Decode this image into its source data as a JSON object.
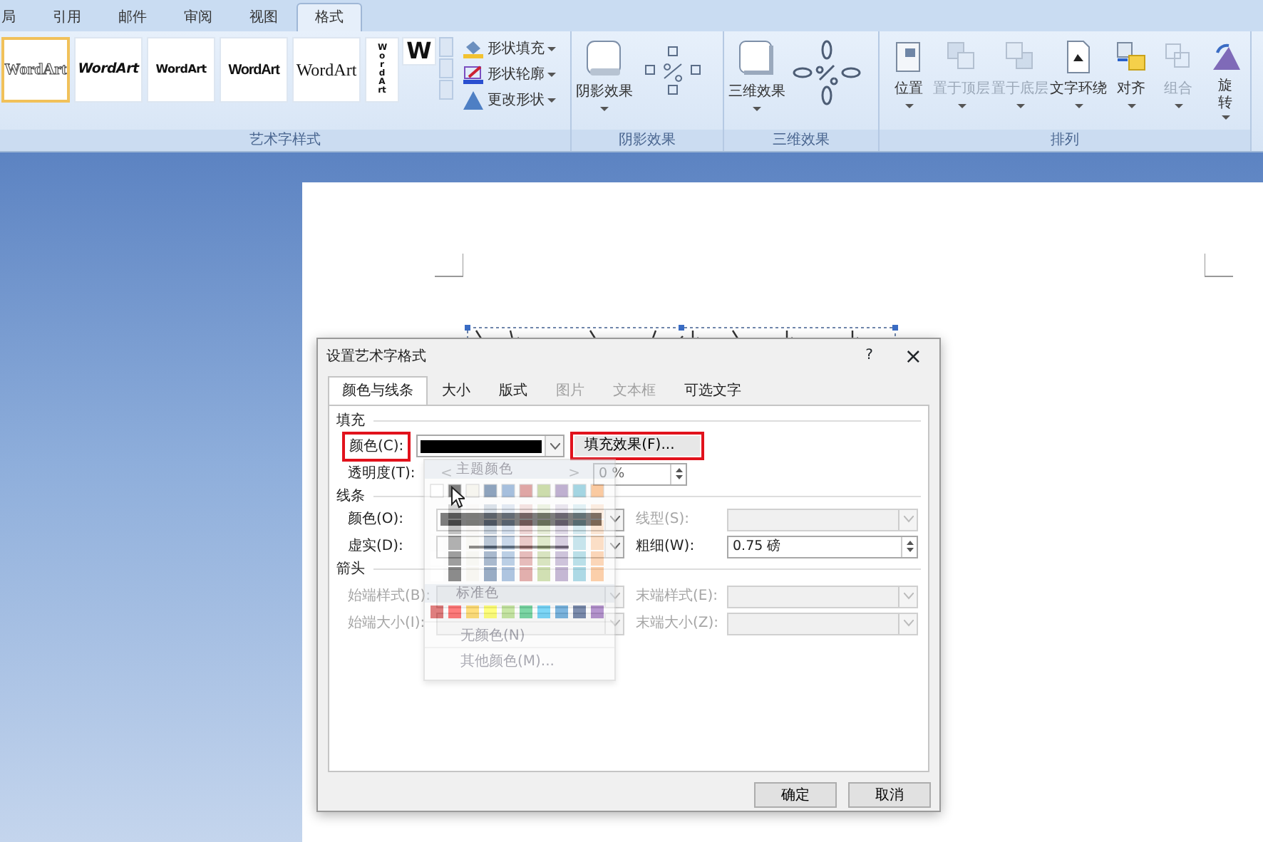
{
  "ribbon_tabs": [
    {
      "label": "局",
      "selected": false
    },
    {
      "label": "引用",
      "selected": false
    },
    {
      "label": "邮件",
      "selected": false
    },
    {
      "label": "审阅",
      "selected": false
    },
    {
      "label": "视图",
      "selected": false
    },
    {
      "label": "格式",
      "selected": true
    }
  ],
  "wordart_styles": {
    "group_label": "艺术字样式",
    "gallery": [
      {
        "text": "WordArt",
        "kind": "outline",
        "selected": true
      },
      {
        "text": "WordArt",
        "kind": "slanted",
        "selected": false
      },
      {
        "text": "WordArt",
        "kind": "arched",
        "selected": false
      },
      {
        "text": "WordArt",
        "kind": "condensed",
        "selected": false
      },
      {
        "text": "WordArt",
        "kind": "serif",
        "selected": false
      },
      {
        "text": "WordArt",
        "kind": "vertical",
        "selected": false
      },
      {
        "text": "W",
        "kind": "block",
        "selected": false
      }
    ],
    "commands": [
      {
        "label": "形状填充",
        "kind": "fill"
      },
      {
        "label": "形状轮廓",
        "kind": "outline"
      },
      {
        "label": "更改形状",
        "kind": "shape"
      }
    ]
  },
  "shadow_effects": {
    "button": "阴影效果",
    "group_label": "阴影效果"
  },
  "three_d_effects": {
    "button": "三维效果",
    "group_label": "三维效果"
  },
  "arrange": {
    "group_label": "排列",
    "items": [
      {
        "label": "位置",
        "kind": "position",
        "disabled": false
      },
      {
        "label": "置于顶层",
        "kind": "front",
        "disabled": true
      },
      {
        "label": "置于底层",
        "kind": "back",
        "disabled": true
      },
      {
        "label": "文字环绕",
        "kind": "wrap",
        "disabled": false
      },
      {
        "label": "对齐",
        "kind": "align",
        "disabled": false
      },
      {
        "label": "组合",
        "kind": "group",
        "disabled": true
      },
      {
        "label": "旋转",
        "kind": "rotate",
        "disabled": false
      }
    ]
  },
  "dialog": {
    "title": "设置艺术字格式",
    "help": "?",
    "close": "×",
    "tabs": [
      {
        "label": "颜色与线条",
        "selected": true,
        "disabled": false
      },
      {
        "label": "大小",
        "selected": false,
        "disabled": false
      },
      {
        "label": "版式",
        "selected": false,
        "disabled": false
      },
      {
        "label": "图片",
        "selected": false,
        "disabled": true
      },
      {
        "label": "文本框",
        "selected": false,
        "disabled": true
      },
      {
        "label": "可选文字",
        "selected": false,
        "disabled": false
      }
    ],
    "fill": {
      "heading": "填充",
      "color_label": "颜色(C):",
      "color_label_highlighted": true,
      "effects_button": "填充效果(F)...",
      "effects_button_highlighted": true,
      "transparency_label": "透明度(T):",
      "slider_left": "<",
      "slider_right": ">",
      "transparency_value": "0 %"
    },
    "line": {
      "heading": "线条",
      "color_label": "颜色(O):",
      "style_label": "线型(S):",
      "dash_label": "虚实(D):",
      "weight_label": "粗细(W):",
      "weight_value": "0.75 磅"
    },
    "arrows": {
      "heading": "箭头",
      "begin_style_label": "始端样式(B):",
      "end_style_label": "末端样式(E):",
      "begin_size_label": "始端大小(I):",
      "end_size_label": "末端大小(Z):"
    },
    "color_menu": {
      "theme_heading": "主题颜色",
      "standard_heading": "标准色",
      "no_color": "无颜色(N)",
      "more_colors": "其他颜色(M)..."
    },
    "buttons": [
      {
        "label": "确定"
      },
      {
        "label": "取消"
      }
    ]
  }
}
